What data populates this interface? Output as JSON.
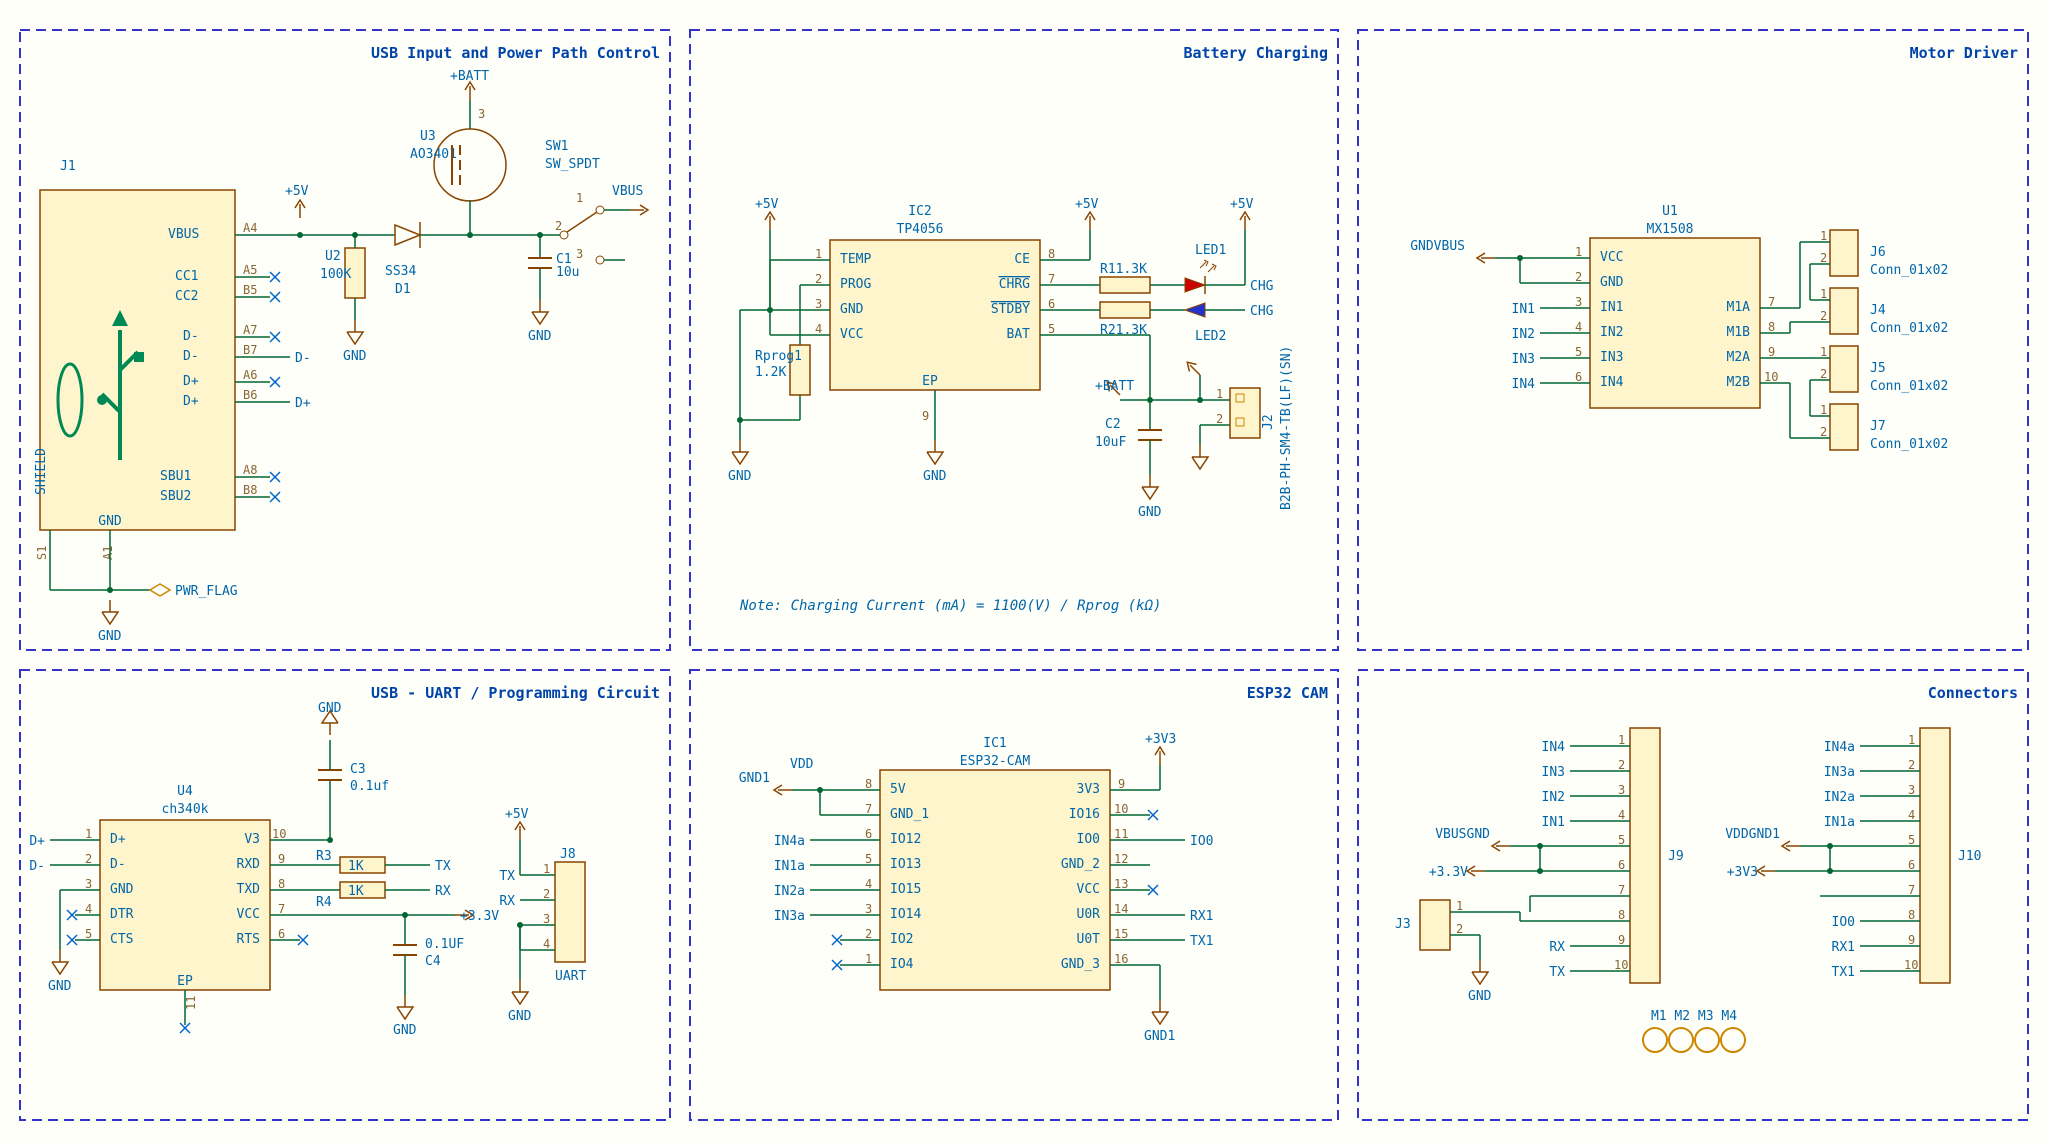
{
  "blocks": {
    "usb_power": {
      "title": "USB Input and Power Path Control"
    },
    "battery": {
      "title": "Battery Charging",
      "note": "Note: Charging Current (mA) = 1100(V) / Rprog (kΩ)"
    },
    "motor": {
      "title": "Motor Driver"
    },
    "uart": {
      "title": "USB - UART / Programming Circuit"
    },
    "esp32": {
      "title": "ESP32 CAM"
    },
    "conn": {
      "title": "Connectors"
    }
  },
  "refs": {
    "J1": "J1",
    "U2": "U2",
    "U2v": "100K",
    "U3": "U3",
    "U3v": "AO3401",
    "D1": "D1",
    "D1v": "SS34",
    "SW1": "SW1",
    "SW1v": "SW_SPDT",
    "C1": "C1",
    "C1v": "10u",
    "IC2": "IC2",
    "IC2v": "TP4056",
    "Rp": "Rprog1",
    "Rpv": "1.2K",
    "R1": "R11.3K",
    "R2": "R21.3K",
    "LED1": "LED1",
    "LED2": "LED2",
    "C2": "C2",
    "C2v": "10uF",
    "J2": "J2",
    "J2v": "B2B-PH-SM4-TB(LF)(SN)",
    "U1": "U1",
    "U1v": "MX1508",
    "J4": "J4",
    "J5": "J5",
    "J6": "J6",
    "J7": "J7",
    "Jc": "Conn_01x02",
    "U4": "U4",
    "U4v": "ch340k",
    "C3": "C3",
    "C3v": "0.1uf",
    "C4": "C4",
    "C4v": "0.1UF",
    "R3": "R3",
    "R4": "R4",
    "Rk": "1K",
    "J8": "J8",
    "J8v": "UART",
    "IC1": "IC1",
    "IC1v": "ESP32-CAM",
    "J3": "J3",
    "J9": "J9",
    "J10": "J10",
    "M": "M1 M2 M3 M4"
  },
  "nets": {
    "VBUS": "VBUS",
    "P5V": "+5V",
    "BATT": "+BATT",
    "GND": "GND",
    "GND1": "GND1",
    "P3V3": "+3.3V",
    "P3V3b": "+3V3",
    "PWRF": "PWR_FLAG",
    "CHG": "CHG",
    "VDD": "VDD",
    "TX": "TX",
    "RX": "RX",
    "TX1": "TX1",
    "RX1": "RX1",
    "IN1": "IN1",
    "IN2": "IN2",
    "IN3": "IN3",
    "IN4": "IN4",
    "IN1a": "IN1a",
    "IN2a": "IN2a",
    "IN3a": "IN3a",
    "IN4a": "IN4a",
    "IO0": "IO0",
    "Dp": "D+",
    "Dm": "D-",
    "GNDVBUS": "GNDVBUS",
    "VBUSGND": "VBUSGND",
    "VDDGND1": "VDDGND1"
  },
  "usb_pins": {
    "VBUS": "VBUS",
    "CC1": "CC1",
    "CC2": "CC2",
    "Dm": "D-",
    "Dp": "D+",
    "SBU1": "SBU1",
    "SBU2": "SBU2",
    "SH": "SHIELD",
    "G": "GND",
    "A4": "A4",
    "A5": "A5",
    "B5": "B5",
    "A7": "A7",
    "B7": "B7",
    "A6": "A6",
    "B6": "B6",
    "A8": "A8",
    "B8": "B8",
    "S1": "S1",
    "A1": "A1"
  },
  "tp_pins": {
    "p1": "TEMP",
    "p2": "PROG",
    "p3": "GND",
    "p4": "VCC",
    "p8": "CE",
    "p7": "CHRG",
    "p6": "STDBY",
    "p5": "BAT",
    "ep": "EP"
  },
  "mx_pins": {
    "VCC": "VCC",
    "GND": "GND",
    "IN1": "IN1",
    "IN2": "IN2",
    "IN3": "IN3",
    "IN4": "IN4",
    "M1A": "M1A",
    "M1B": "M1B",
    "M2A": "M2A",
    "M2B": "M2B"
  },
  "ch_pins": {
    "Dp": "D+",
    "Dm": "D-",
    "GND": "GND",
    "DTR": "DTR",
    "CTS": "CTS",
    "V3": "V3",
    "RXD": "RXD",
    "TXD": "TXD",
    "VCC": "VCC",
    "RTS": "RTS",
    "EP": "EP"
  },
  "esp_pins": {
    "p8": "5V",
    "p7": "GND_1",
    "p6": "IO12",
    "p5": "IO13",
    "p4": "IO15",
    "p3": "IO14",
    "p2": "IO2",
    "p1": "IO4",
    "p9": "3V3",
    "p10": "IO16",
    "p11": "IO0",
    "p12": "GND_2",
    "p13": "VCC",
    "p14": "U0R",
    "p15": "U0T",
    "p16": "GND_3"
  },
  "j8_pins": {
    "p1": "TX",
    "p2": "RX",
    "p3": "",
    "p4": ""
  }
}
